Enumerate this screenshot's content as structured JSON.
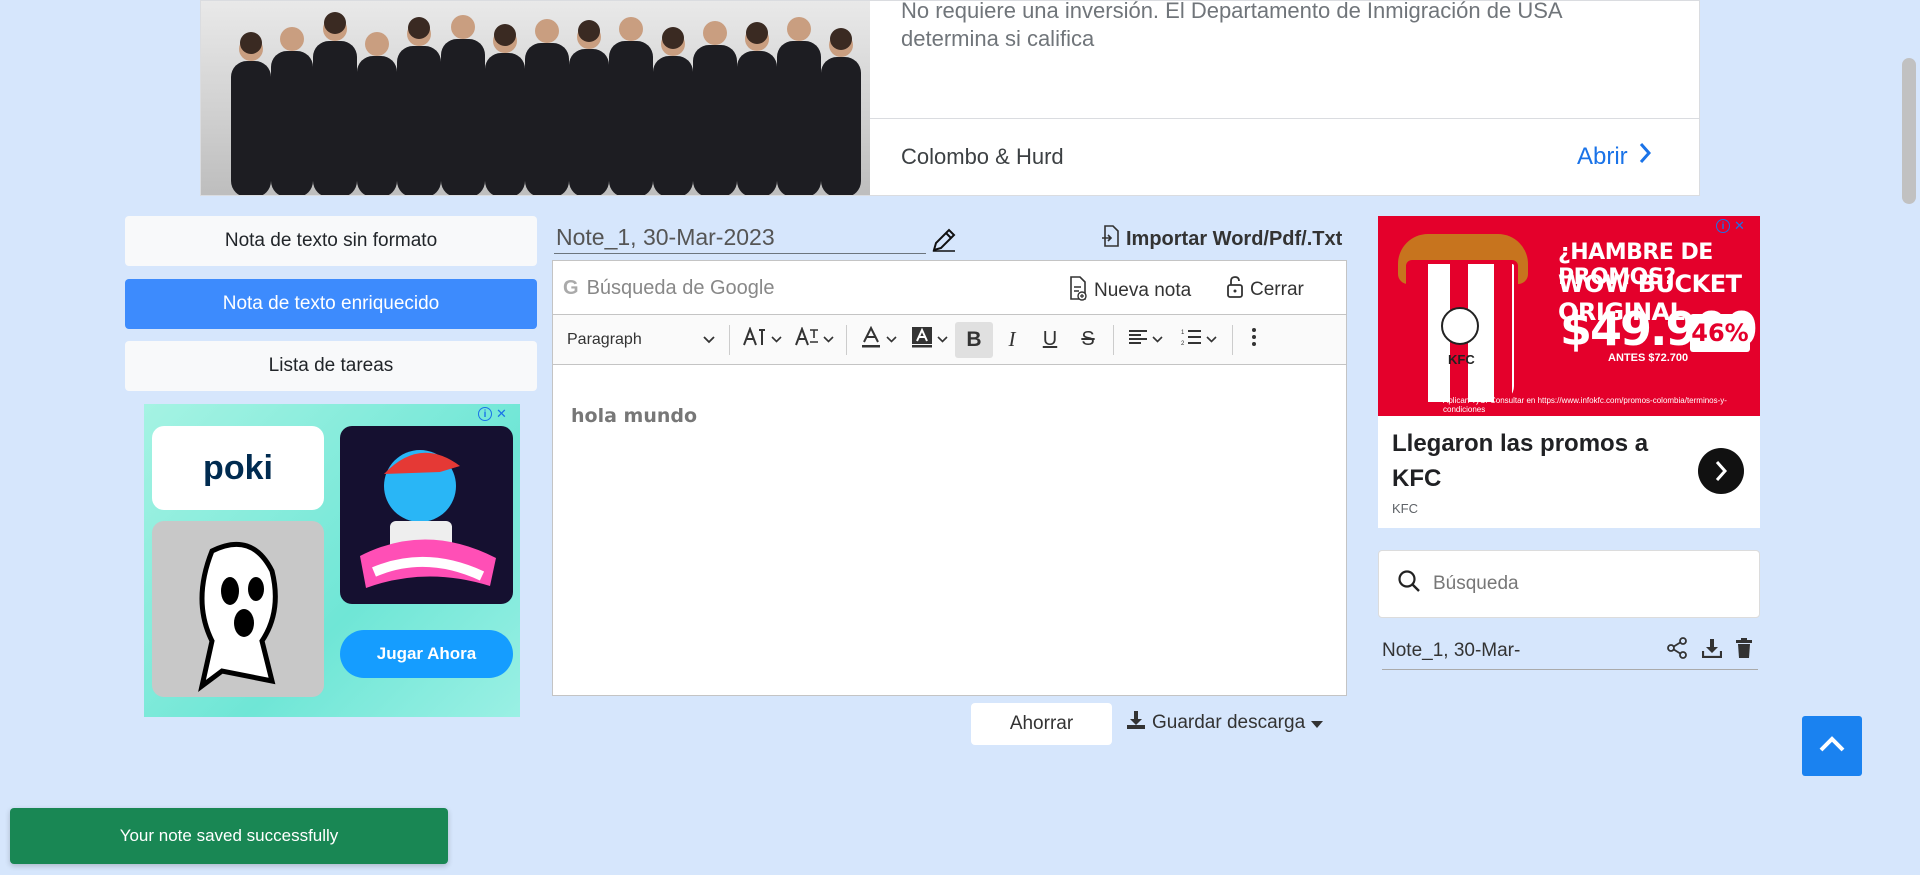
{
  "top_ad": {
    "text": "No requiere una inversión. El Departamento de Inmigración de USA determina si califica",
    "advertiser": "Colombo & Hurd",
    "cta": "Abrir"
  },
  "note_types": {
    "plain": "Nota de texto sin formato",
    "rich": "Nota de texto enriquecido",
    "tasks": "Lista de tareas"
  },
  "left_ad": {
    "logo": "poki",
    "cta": "Jugar Ahora"
  },
  "note": {
    "title": "Note_1, 30-Mar-2023",
    "content": "hola mundo"
  },
  "header": {
    "import_label": "Importar Word/Pdf/.Txt"
  },
  "editor_bar": {
    "search_placeholder": "Búsqueda de Google",
    "new_note": "Nueva nota",
    "close": "Cerrar"
  },
  "toolbar": {
    "block_format": "Paragraph",
    "icons": [
      "font-size-icon",
      "font-family-icon",
      "font-color-icon",
      "highlight-color-icon",
      "bold-icon",
      "italic-icon",
      "underline-icon",
      "strikethrough-icon",
      "align-icon",
      "numbered-list-icon",
      "more-icon"
    ],
    "active": "bold"
  },
  "actions": {
    "save": "Ahorrar",
    "download": "Guardar descarga"
  },
  "right_ad": {
    "headline_1": "¿HAMBRE DE PROMOS?",
    "headline_2": "WOW BUCKET ORIGINAL",
    "price": "$49.900",
    "discount": "46%",
    "before_price": "ANTES $72.700",
    "legal": "Aplican TyC. Consultar en https://www.infokfc.com/promos-colombia/terminos-y-condiciones",
    "title": "Llegaron las promos a KFC",
    "brand": "KFC"
  },
  "sidebar": {
    "search_placeholder": "Búsqueda",
    "notes": [
      {
        "title": "Note_1, 30-Mar-"
      }
    ]
  },
  "toast": {
    "message": "Your note saved successfully",
    "color": "#198754"
  },
  "colors": {
    "background": "#d6e6fc",
    "accent": "#3d8bfd",
    "scroll_top": "#1a82f0"
  }
}
